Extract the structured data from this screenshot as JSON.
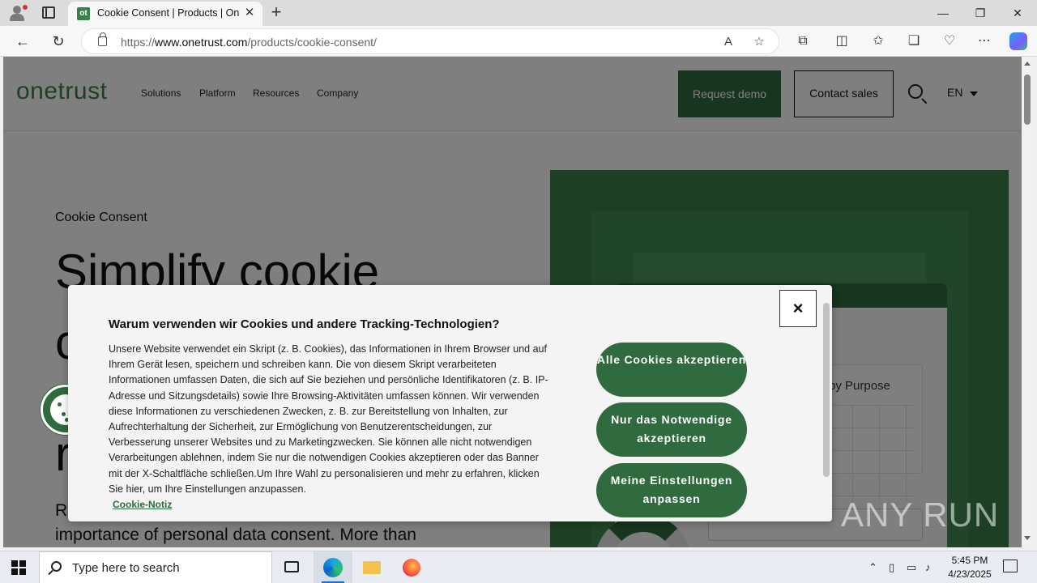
{
  "browser": {
    "tab_favicon": "ot",
    "tab_title": "Cookie Consent | Products | OneTrust",
    "tab_close": "✕",
    "new_tab": "+",
    "url_prefix": "https://",
    "url_host": "www.onetrust.com",
    "url_path": "/products/cookie-consent/",
    "window_controls": {
      "minimize": "—",
      "maximize": "❐",
      "close": "✕"
    }
  },
  "site": {
    "logo": "onetrust",
    "nav": [
      "Solutions",
      "Platform",
      "Resources",
      "Company"
    ],
    "request_demo": "Request demo",
    "contact_sales": "Contact sales",
    "language": "EN",
    "accent_color": "#2f6b3e"
  },
  "hero": {
    "eyebrow": "Cookie Consent",
    "title_line1": "Simplify cookie",
    "glyph_c": "c",
    "glyph_r": "r",
    "subtitle_fragment_1": "R",
    "subtitle_line2": "importance of personal data consent. More than",
    "art_label": "by Purpose"
  },
  "consent_dialog": {
    "title": "Warum verwenden wir Cookies und andere Tracking-Technologien?",
    "body": "Unsere Website verwendet ein Skript (z. B. Cookies), das Informationen in Ihrem Browser und auf Ihrem Gerät lesen, speichern und schreiben kann. Die von diesem Skript verarbeiteten Informationen umfassen Daten, die sich auf Sie beziehen und persönliche Identifikatoren (z. B. IP-Adresse und Sitzungsdetails) sowie Ihre Browsing-Aktivitäten umfassen können. Wir verwenden diese Informationen zu verschiedenen Zwecken, z. B. zur Bereitstellung von Inhalten, zur Aufrechterhaltung der Sicherheit, zur Ermöglichung von Benutzerentscheidungen, zur Verbesserung unserer Websites und zu Marketingzwecken. Sie können alle nicht notwendigen Verarbeitungen ablehnen, indem Sie nur die notwendigen Cookies akzeptieren oder das Banner mit der X-Schaltfläche schließen.Um Ihre Wahl zu personalisieren und mehr zu erfahren, klicken Sie hier, um Ihre Einstellungen anzupassen.",
    "link": "Cookie-Notiz",
    "close": "×",
    "accept_all": "Alle Cookies akzeptieren",
    "necessary_only": "Nur das Notwendige akzeptieren",
    "customize": "Meine Einstellungen anpassen"
  },
  "watermark": "ANY RUN",
  "taskbar": {
    "search_placeholder": "Type here to search",
    "time": "5:45 PM",
    "date": "4/23/2025"
  }
}
